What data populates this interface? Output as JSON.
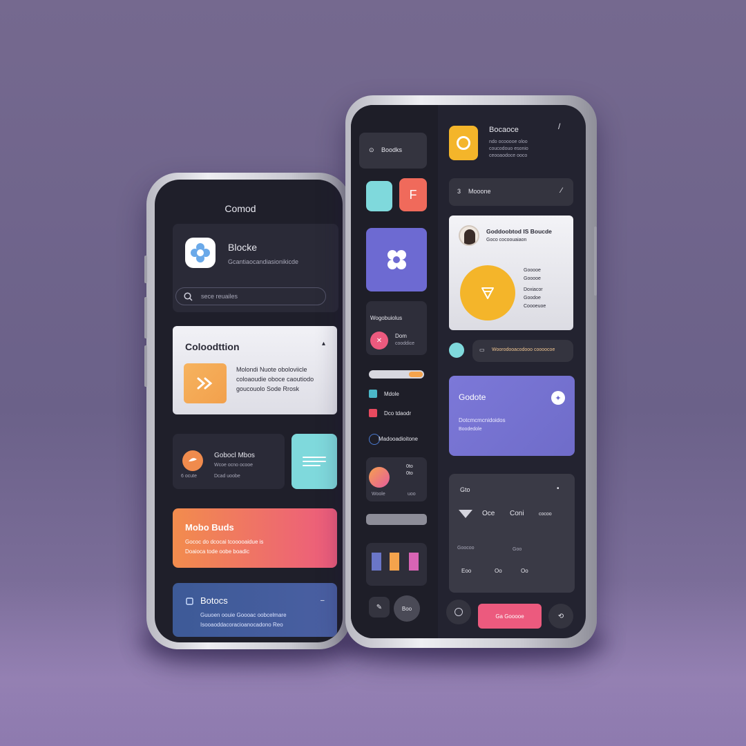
{
  "left_phone": {
    "title": "Comod",
    "profile_card": {
      "title": "Blocke",
      "subtitle": "Gcantiaocandiasionikicde"
    },
    "search": {
      "placeholder": "sece reuailes"
    },
    "collection_card": {
      "title": "Coloodttion",
      "body_line1": "Molondi Nuote oboloviicle",
      "body_line2": "coloaoudie oboce caoutiodo",
      "body_line3": "goucouolo Sode Rrosk"
    },
    "contact_card": {
      "title": "Gobocl Mbos",
      "line1": "Wcoe ocno ocooe",
      "line2": "Dcad uoobe",
      "line3": "6 ocute"
    },
    "orange_card": {
      "title": "Mobo Buds",
      "line1": "Gococ do dcocai tcooooaidue is",
      "line2": "Doaioca tode oobe boadic"
    },
    "blue_card": {
      "title": "Botocs",
      "line1": "Guuoen oouie Goooac oobcelmare",
      "line2": "Isooaoddacoracioanocadono Reo"
    }
  },
  "right_phone": {
    "sidebar": {
      "top_chip": "Boodks",
      "card_label": "Wogobuiolus",
      "row_text": "Dom",
      "row_sub": "cooddice",
      "legend1": "Mdole",
      "legend2": "Dco tdaodr",
      "toggle_label": "Madooadioitone",
      "stat_val": "0to",
      "stat_val2": "0to",
      "stat_sub": "Woole",
      "stat_sub2": "uoo",
      "bottom_btn": "Boo"
    },
    "header": {
      "title": "Bocaoce",
      "line1": "ndo ocooooe oloo",
      "line2": "coucodouo esonio",
      "line3": "ceooaodoce ooco",
      "menu": "/"
    },
    "search_bar": {
      "label": "Mooone",
      "num": "3"
    },
    "profile_card": {
      "title": "Goddoobtod IS Boucde",
      "subtitle": "Goco cocoouaiaon",
      "side1": "Gooooe",
      "side2": "Gooooe",
      "side3": "Doxiacor",
      "side4": "Goodoe",
      "side5": "Coooeuoe"
    },
    "pill": {
      "label": "Woorodooacodooo coooocoe"
    },
    "purple_card": {
      "title": "Godote",
      "line1": "Dotcmcmcnidoidos",
      "line2": "Boodedole"
    },
    "dark_card": {
      "title": "Gto",
      "item1": "Oce",
      "item2": "Coni",
      "item3": "cocoo",
      "label1": "Goocoo",
      "label2": "Goo",
      "num1": "Eoo",
      "num2": "Oo",
      "num3": "Oo"
    },
    "bottom_bar": {
      "button": "Ga Gooooe"
    }
  },
  "colors": {
    "bg": "#6e6389",
    "screen": "#1f1f2a",
    "card_dark": "#2a2a37",
    "teal": "#7fd9dc",
    "coral": "#f06a5b",
    "indigo": "#6d6ad2",
    "yellow": "#f4b52a",
    "pink": "#ec5a7e",
    "orange_grad_start": "#f28c4d",
    "orange_grad_end": "#ec5b7e",
    "blue_card": "#3d5a97",
    "purple_card": "#7c78d8"
  },
  "icons": [
    "flower-icon",
    "search-icon",
    "chevron-icon",
    "arrows-icon",
    "heart-icon",
    "lines-icon",
    "file-icon",
    "dots-icon",
    "cone-icon",
    "avatar-icon",
    "star-icon",
    "circle-icon",
    "back-icon"
  ]
}
